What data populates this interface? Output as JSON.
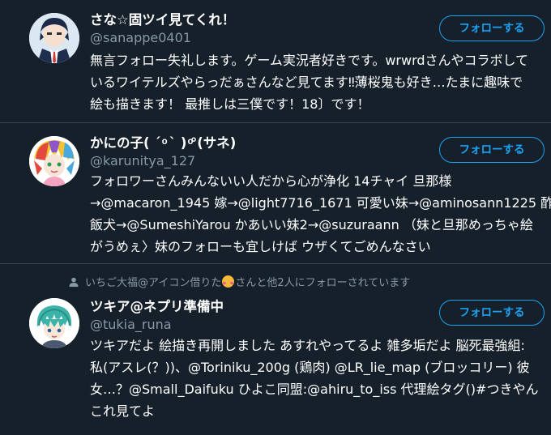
{
  "users": [
    {
      "name": "さな☆固ツイ見てくれ！",
      "handle": "@sanappe0401",
      "follow_label": "フォローする",
      "bio_lines": [
        "無言フォロー失礼します。ゲーム実況者好きです。wrwrdさんやコラボして",
        "いるワイテルズやらっだぁさんなど見てます‼薄桜鬼も好き…たまに趣味で",
        "絵も描きます！ 最推しは三僕です！18〕です！"
      ]
    },
    {
      "name": "かにの子( ´ ͦ ` ) ͦ°(サネ)",
      "handle": "@karunitya_127",
      "follow_label": "フォローする",
      "bio_lines": [
        "フォロワーさんみんないい人だから心が浄化 14チャイ 旦那様",
        "→@macaron_1945 嫁→@light7716_1671 可愛い妹→@aminosann1225 酢",
        "飯犬→@SumeshiYarou かあいい妹2→@suzuraann （妹と旦那めっちゃ絵",
        "がうめぇ〉妹のフォローも宜しけば ウザくてごめんなさい"
      ]
    },
    {
      "social_context_before": "いちご大福@アイコン借りた",
      "social_context_after": "さんと他2人にフォローされています",
      "name": "ツキア@ネプリ準備中",
      "handle": "@tukia_runa",
      "follow_label": "フォローする",
      "bio_lines": [
        "ツキアだよ 絵描き再開しました あすれやってるよ 雑多垢だよ 脳死最強組:",
        "私(アスレ(？))、@Toriniku_200g (鶏肉) @LR_lie_map (ブロッコリー) 彼",
        "女…？@Small_Daifuku ひよこ同盟:@ahiru_to_iss 代理絵タグ()#つきやん",
        "これ見てよ"
      ]
    }
  ],
  "icons": {
    "avatar_0": "avatar-boy-suit-icon",
    "avatar_1": "avatar-colorful-hair-icon",
    "avatar_2": "avatar-teal-hair-icon",
    "social": "person-icon",
    "emoji": "smiling-face-hearts-emoji"
  },
  "colors": {
    "background": "#15202b",
    "accent": "#1da1f2",
    "secondary_text": "#8899a6",
    "divider": "#38444d"
  }
}
